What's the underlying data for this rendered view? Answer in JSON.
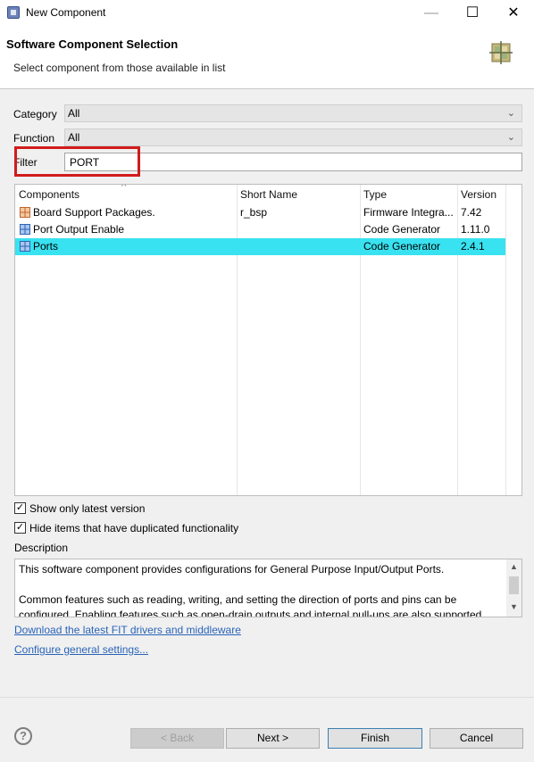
{
  "window": {
    "title": "New Component",
    "minimize_glyph": "—",
    "maximize_glyph": "☐",
    "close_glyph": "✕"
  },
  "header": {
    "title": "Software Component Selection",
    "description": "Select component from those available in list",
    "icon": "grid-wizard-icon"
  },
  "form": {
    "category_label": "Category",
    "category_value": "All",
    "function_label": "Function",
    "function_value": "All",
    "filter_label": "Filter",
    "filter_value": "PORT",
    "filter_highlight_color": "#d11b1b"
  },
  "table": {
    "sort_indicator": "^",
    "columns": [
      "Components",
      "Short Name",
      "Type",
      "Version"
    ],
    "rows": [
      {
        "icon": "bsp-grid-icon",
        "component": "Board Support Packages.",
        "short_name": "r_bsp",
        "type": "Firmware Integra...",
        "version": "7.42"
      },
      {
        "icon": "code-generator-grid-icon",
        "component": "Port Output Enable",
        "short_name": "",
        "type": "Code Generator",
        "version": "1.11.0"
      },
      {
        "icon": "code-generator-grid-icon",
        "component": "Ports",
        "short_name": "",
        "type": "Code Generator",
        "version": "2.4.1",
        "selected": true
      }
    ],
    "selection_color": "#38e2f0"
  },
  "options": {
    "latest_version_label": "Show only latest version",
    "latest_version_checked": true,
    "hide_duplicates_label": "Hide items that have duplicated functionality",
    "hide_duplicates_checked": true
  },
  "description": {
    "label": "Description",
    "line1": "This software component provides configurations for General Purpose Input/Output Ports.",
    "line2": "Common features such as reading, writing, and setting the direction of ports and pins can be",
    "line3": "configured. Enabling features such as open-drain outputs and internal pull-ups are also supported."
  },
  "links": {
    "download": "Download the latest FIT drivers and middleware",
    "configure": "Configure general settings..."
  },
  "buttons": {
    "help": "?",
    "back": "< Back",
    "next": "Next >",
    "finish": "Finish",
    "cancel": "Cancel"
  }
}
